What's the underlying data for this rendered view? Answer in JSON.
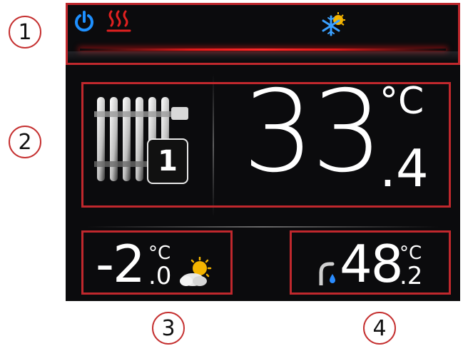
{
  "labels": [
    "1",
    "2",
    "3",
    "4"
  ],
  "topbar": {
    "icons": [
      "power-icon",
      "heating-icon",
      "snowflake-sun-icon"
    ],
    "colors": {
      "power": "#1e90ff",
      "heating": "#e02020",
      "accent": "#e01a1a"
    }
  },
  "main": {
    "temperature_integer": "33",
    "temperature_unit": "°C",
    "temperature_decimal": ".4",
    "zone_number": "1",
    "icon": "radiator-icon"
  },
  "outdoor": {
    "temperature_integer": "-2",
    "temperature_unit": "°C",
    "temperature_decimal": ".0",
    "icon": "partly-cloudy-icon"
  },
  "water": {
    "temperature_integer": "48",
    "temperature_unit": "°C",
    "temperature_decimal": ".2",
    "icon": "faucet-icon"
  }
}
